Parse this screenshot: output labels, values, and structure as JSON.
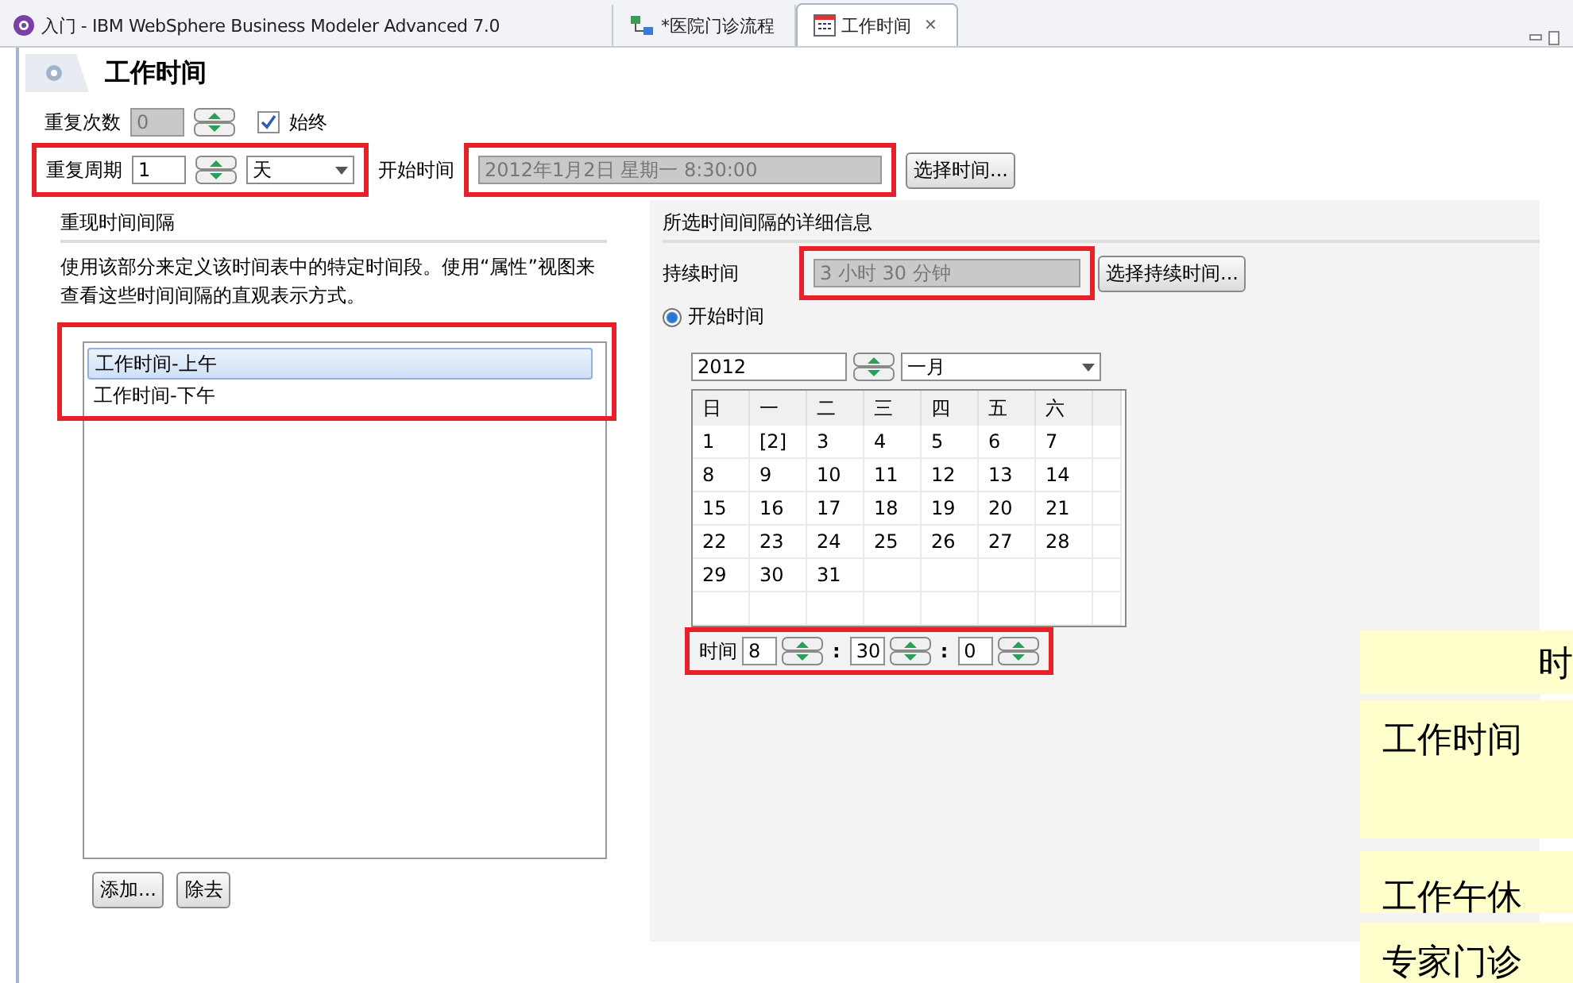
{
  "tabs": [
    {
      "label": "入门 - IBM WebSphere Business Modeler Advanced 7.0",
      "selected": false,
      "kind": "welcome"
    },
    {
      "label": "*医院门诊流程",
      "selected": false,
      "kind": "process"
    },
    {
      "label": "工作时间",
      "selected": true,
      "kind": "calendar",
      "close": "✕"
    }
  ],
  "editor": {
    "title": "工作时间"
  },
  "repeat_count": {
    "label": "重复次数",
    "value": "0",
    "disabled": true
  },
  "always": {
    "label": "始终",
    "checked": true
  },
  "repeat_period": {
    "label": "重复周期",
    "value": "1",
    "unit": "天",
    "highlighted": true
  },
  "start_time": {
    "label": "开始时间",
    "value": "2012年1月2日 星期一 8:30:00",
    "highlighted": true,
    "button": "选择时间..."
  },
  "intervals": {
    "title": "重现时间间隔",
    "description": "使用该部分来定义该时间表中的特定时间段。使用“属性”视图来查看这些时间间隔的直观表示方式。",
    "highlighted": true,
    "items": [
      {
        "label": "工作时间-上午",
        "selected": true
      },
      {
        "label": "工作时间-下午",
        "selected": false
      }
    ],
    "buttons": [
      "添加...",
      "除去"
    ]
  },
  "details": {
    "title": "所选时间间隔的详细信息",
    "duration": {
      "label": "持续时间",
      "value": "3 小时 30 分钟",
      "highlighted": true,
      "button": "选择持续时间..."
    },
    "start_radio": {
      "label": "开始时间",
      "selected": true
    },
    "year": "2012",
    "month": "一月",
    "weekdays": [
      "日",
      "一",
      "二",
      "三",
      "四",
      "五",
      "六"
    ],
    "weeks": [
      [
        "1",
        "[2]",
        "3",
        "4",
        "5",
        "6",
        "7"
      ],
      [
        "8",
        "9",
        "10",
        "11",
        "12",
        "13",
        "14"
      ],
      [
        "15",
        "16",
        "17",
        "18",
        "19",
        "20",
        "21"
      ],
      [
        "22",
        "23",
        "24",
        "25",
        "26",
        "27",
        "28"
      ],
      [
        "29",
        "30",
        "31"
      ]
    ],
    "time": {
      "label": "时间",
      "hour": "8",
      "minute": "30",
      "second": "0",
      "separator": ":",
      "highlighted": true
    }
  },
  "overlay": {
    "kind": "picture",
    "heading": "时",
    "rows": [
      "工作时间",
      "工作午休",
      "专家门诊"
    ]
  }
}
